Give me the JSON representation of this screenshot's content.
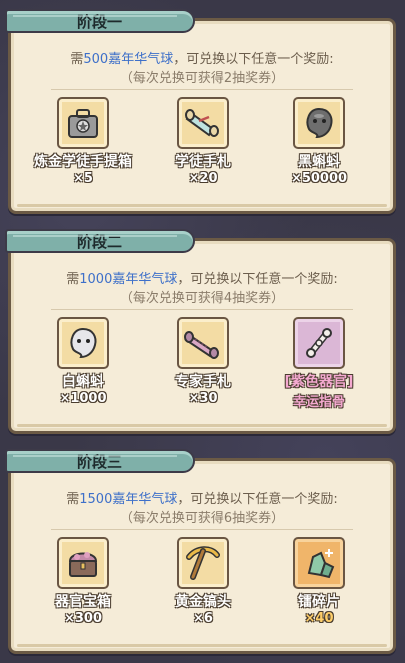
{
  "stages": [
    {
      "title": "阶段一",
      "desc_prefix": "需",
      "desc_highlight": "500嘉年华气球",
      "desc_suffix": "，可兑换以下任意一个奖励:",
      "note": "（每次兑换可获得2抽奖券）",
      "rewards": [
        {
          "name": "炼金学徒手提箱",
          "qty": "×5",
          "icon": "toolbox-icon"
        },
        {
          "name": "学徒手札",
          "qty": "×20",
          "icon": "scroll-icon"
        },
        {
          "name": "黑蝌蚪",
          "qty": "×50000",
          "icon": "black-tadpole-icon"
        }
      ]
    },
    {
      "title": "阶段二",
      "desc_prefix": "需",
      "desc_highlight": "1000嘉年华气球",
      "desc_suffix": "，可兑换以下任意一个奖励:",
      "note": "（每次兑换可获得4抽奖券）",
      "rewards": [
        {
          "name": "白蝌蚪",
          "qty": "×1000",
          "icon": "white-tadpole-icon"
        },
        {
          "name": "专家手札",
          "qty": "×30",
          "icon": "expert-scroll-icon"
        },
        {
          "name": "[紫色器官]",
          "qty": "幸运指骨",
          "icon": "finger-bone-icon"
        }
      ]
    },
    {
      "title": "阶段三",
      "desc_prefix": "需",
      "desc_highlight": "1500嘉年华气球",
      "desc_suffix": "，可兑换以下任意一个奖励:",
      "note": "（每次兑换可获得6抽奖券）",
      "rewards": [
        {
          "name": "器官宝箱",
          "qty": "×300",
          "icon": "organ-chest-icon"
        },
        {
          "name": "黄金镐头",
          "qty": "×6",
          "icon": "golden-pickaxe-icon"
        },
        {
          "name": "镭碎片",
          "qty": "×40",
          "icon": "radium-shard-icon"
        }
      ]
    }
  ]
}
